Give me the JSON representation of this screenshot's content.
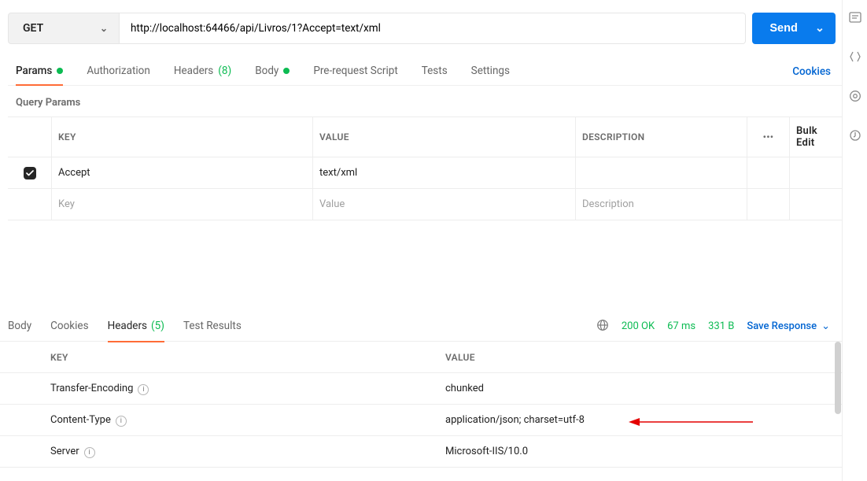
{
  "request": {
    "method": "GET",
    "url": "http://localhost:64466/api/Livros/1?Accept=text/xml",
    "sendLabel": "Send"
  },
  "tabs": {
    "params": "Params",
    "authorization": "Authorization",
    "headers": "Headers",
    "headersCount": "(8)",
    "body": "Body",
    "preRequest": "Pre-request Script",
    "tests": "Tests",
    "settings": "Settings",
    "cookies": "Cookies"
  },
  "queryParams": {
    "title": "Query Params",
    "colKey": "KEY",
    "colValue": "VALUE",
    "colDesc": "DESCRIPTION",
    "bulkEdit": "Bulk Edit",
    "rows": [
      {
        "enabled": true,
        "key": "Accept",
        "value": "text/xml",
        "description": ""
      }
    ],
    "placeholders": {
      "key": "Key",
      "value": "Value",
      "description": "Description"
    }
  },
  "response": {
    "tabs": {
      "body": "Body",
      "cookies": "Cookies",
      "headers": "Headers",
      "headersCount": "(5)",
      "testResults": "Test Results"
    },
    "status": {
      "code": "200 OK",
      "time": "67 ms",
      "size": "331 B"
    },
    "saveResponse": "Save Response",
    "headersTable": {
      "colKey": "KEY",
      "colValue": "VALUE",
      "rows": [
        {
          "key": "Transfer-Encoding",
          "value": "chunked"
        },
        {
          "key": "Content-Type",
          "value": "application/json; charset=utf-8"
        },
        {
          "key": "Server",
          "value": "Microsoft-IIS/10.0"
        }
      ]
    }
  }
}
